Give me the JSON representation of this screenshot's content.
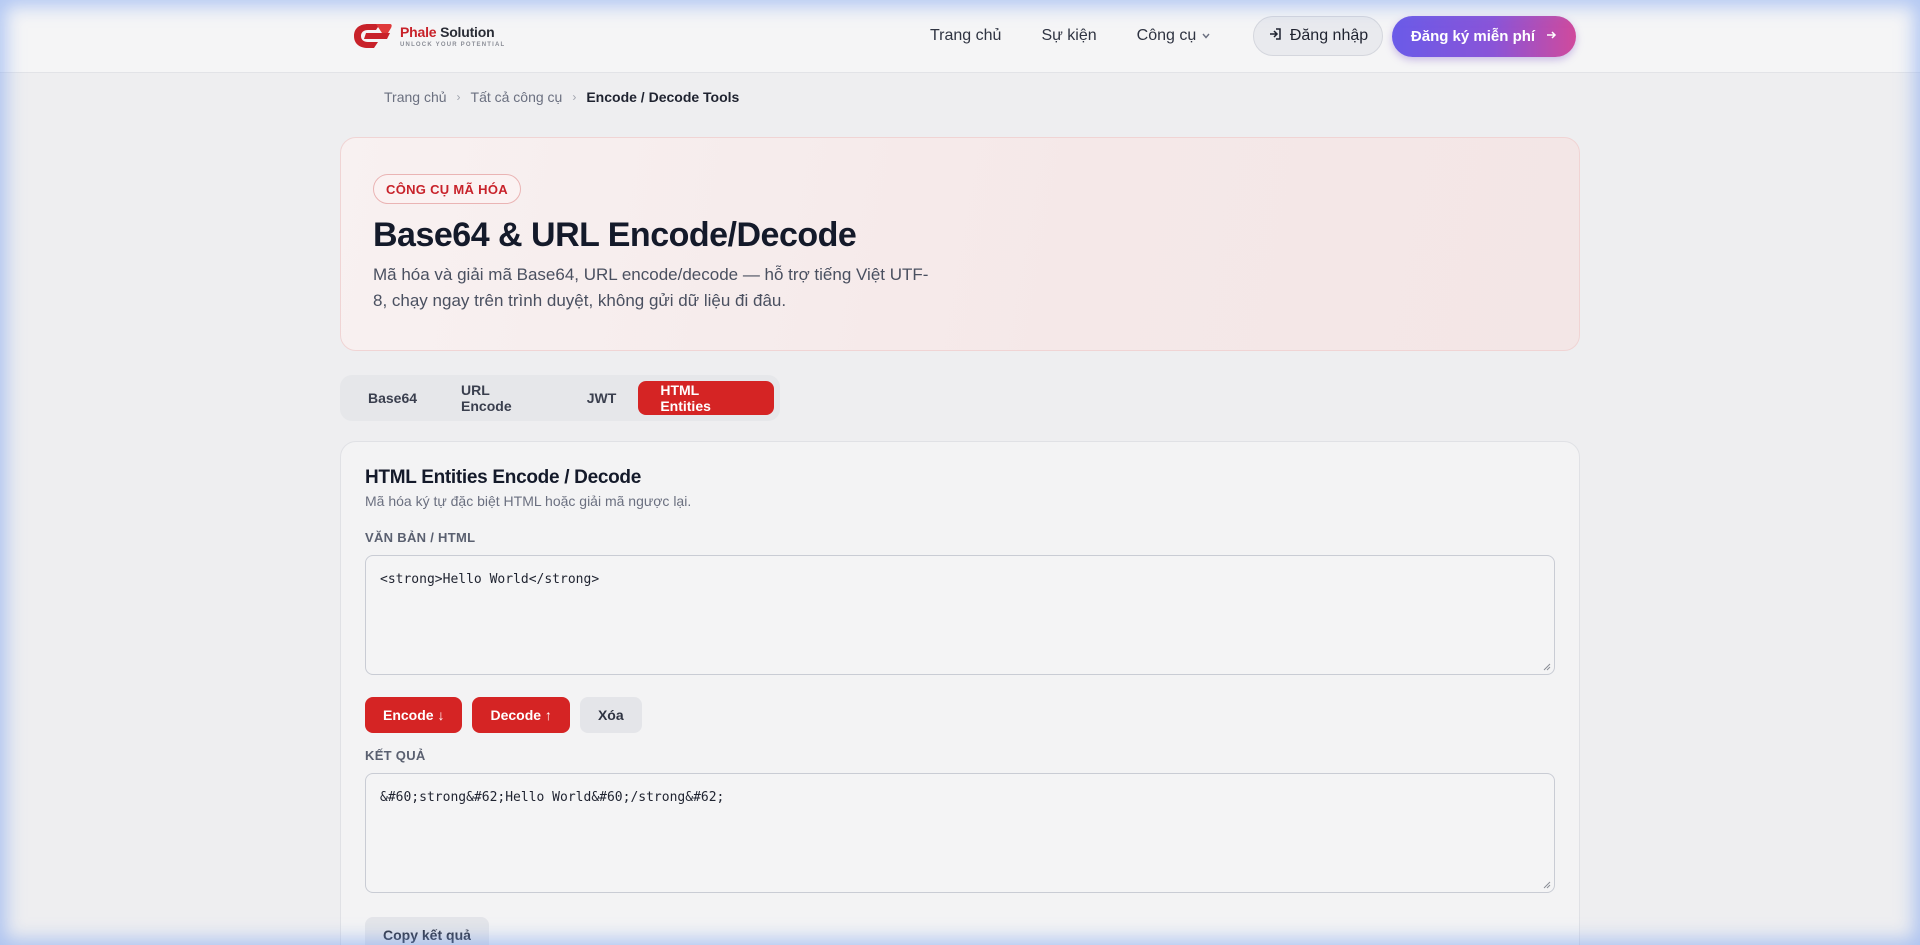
{
  "brand": {
    "name_part1": "Phale",
    "name_part2": "Solution",
    "tagline": "UNLOCK YOUR POTENTIAL",
    "color": "#c8222a"
  },
  "nav": {
    "items": [
      {
        "label": "Trang chủ"
      },
      {
        "label": "Sự kiện"
      },
      {
        "label": "Công cụ",
        "icon": "chevron-down-icon"
      }
    ],
    "login_label": "Đăng nhập",
    "signup_label": "Đăng ký miễn phí"
  },
  "breadcrumb": {
    "items": [
      "Trang chủ",
      "Tất cả công cụ",
      "Encode / Decode Tools"
    ]
  },
  "hero": {
    "badge": "CÔNG CỤ MÃ HÓA",
    "title": "Base64 & URL Encode/Decode",
    "description": "Mã hóa và giải mã Base64, URL encode/decode — hỗ trợ tiếng Việt UTF-8, chạy ngay trên trình duyệt, không gửi dữ liệu đi đâu."
  },
  "tabs": {
    "items": [
      "Base64",
      "URL Encode",
      "JWT",
      "HTML Entities"
    ],
    "active": "HTML Entities"
  },
  "tool": {
    "title": "HTML Entities Encode / Decode",
    "subtitle": "Mã hóa ký tự đặc biệt HTML hoặc giải mã ngược lại.",
    "input_label": "VĂN BẢN / HTML",
    "input_value": "<strong>Hello World</strong>",
    "encode_label": "Encode ↓",
    "decode_label": "Decode ↑",
    "clear_label": "Xóa",
    "output_label": "KẾT QUẢ",
    "output_value": "&#60;strong&#62;Hello World&#60;/strong&#62;",
    "copy_label": "Copy kết quả"
  },
  "colors": {
    "accent": "#d52424",
    "signup_gradient_start": "#6a5be8",
    "signup_gradient_end": "#d04a9c"
  }
}
